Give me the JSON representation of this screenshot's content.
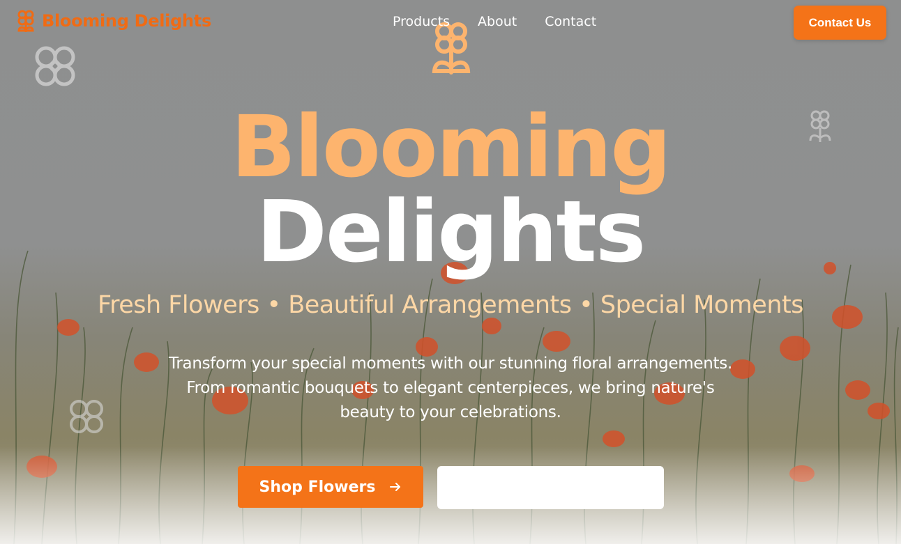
{
  "brand": {
    "name": "Blooming Delights",
    "icon": "flower-icon",
    "color": "#f06b14"
  },
  "nav": {
    "links": [
      {
        "label": "Products"
      },
      {
        "label": "About"
      },
      {
        "label": "Contact"
      }
    ],
    "cta_label": "Contact Us"
  },
  "hero": {
    "title_line1": "Blooming",
    "title_line2": "Delights",
    "tagline": "Fresh Flowers • Beautiful Arrangements • Special Moments",
    "description": "Transform your special moments with our stunning floral arrangements. From romantic bouquets to elegant centerpieces, we bring nature's beauty to your celebrations.",
    "primary_button": {
      "label": "Shop Flowers",
      "icon": "arrow-right-icon"
    },
    "secondary_button": {
      "label": ""
    }
  },
  "colors": {
    "accent": "#f47318",
    "title_peach": "#fdb46e",
    "tagline_peach": "#fdd7a6"
  }
}
